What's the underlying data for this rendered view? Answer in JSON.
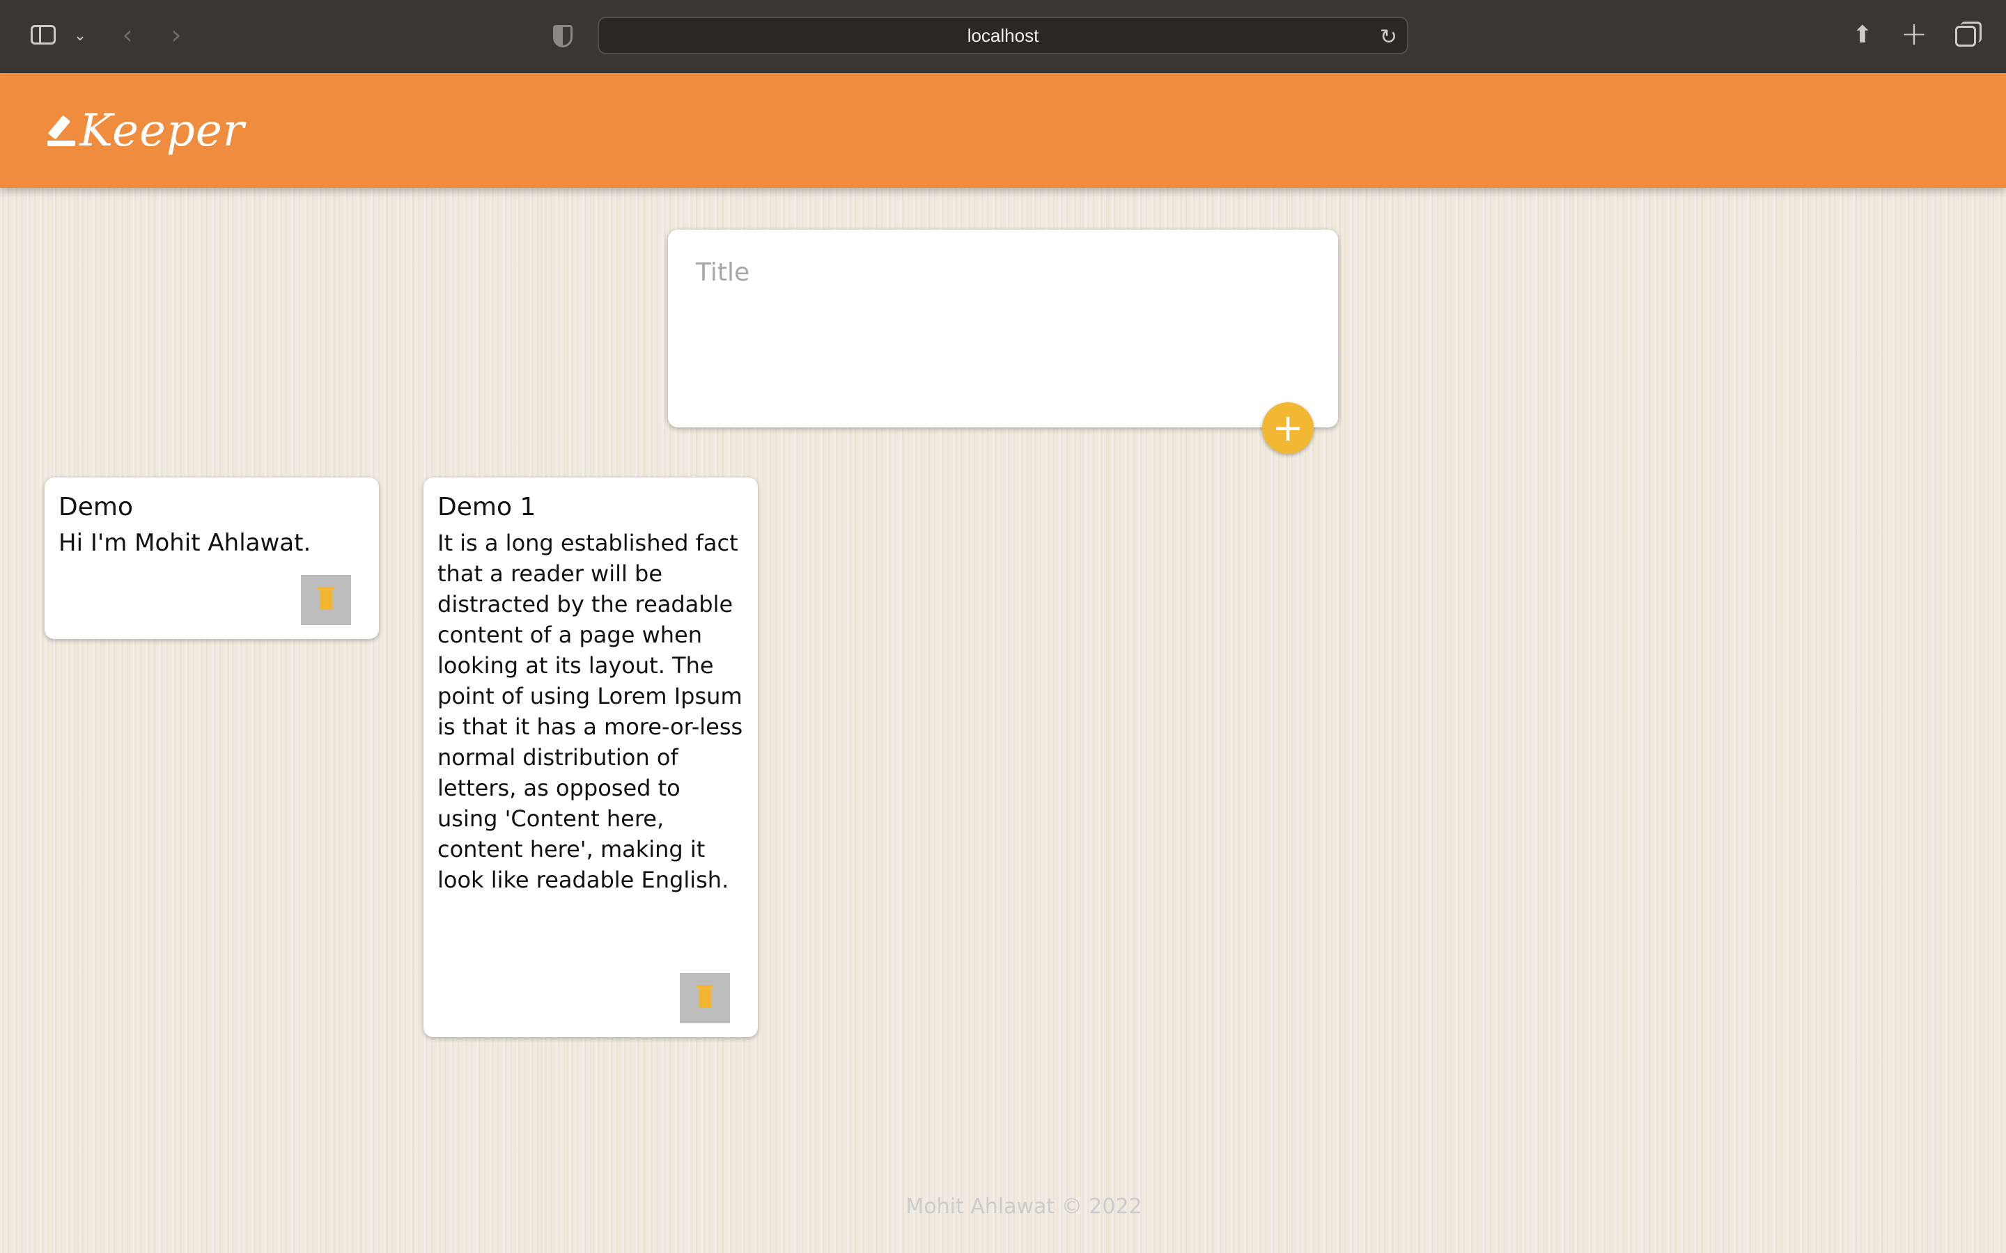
{
  "browser": {
    "url": "localhost",
    "icons": {
      "sidebar": "sidebar-icon",
      "caret": "chevron-down-icon",
      "back": "chevron-left-icon",
      "forward": "chevron-right-icon",
      "privacy": "shield-icon",
      "reload": "reload-icon",
      "share": "share-icon",
      "new_tab": "plus-icon",
      "tabs": "tabs-overview-icon"
    }
  },
  "header": {
    "app_name": "Keeper",
    "icon": "pencil-icon",
    "color": "#ef8c3e"
  },
  "create_note": {
    "title_placeholder": "Title",
    "add_button_label": "+",
    "add_button_color": "#f3b833"
  },
  "notes": [
    {
      "title": "Demo",
      "content": "Hi I'm Mohit Ahlawat.",
      "delete_icon": "trash-icon"
    },
    {
      "title": "Demo 1",
      "content": "It is a long established fact that a reader will be distracted by the readable content of a page when looking at its layout. The point of using Lorem Ipsum is that it has a more-or-less normal distribution of letters, as opposed to using 'Content here, content here', making it look like readable English.",
      "delete_icon": "trash-icon"
    }
  ],
  "footer": {
    "text": "Mohit Ahlawat © 2022"
  }
}
